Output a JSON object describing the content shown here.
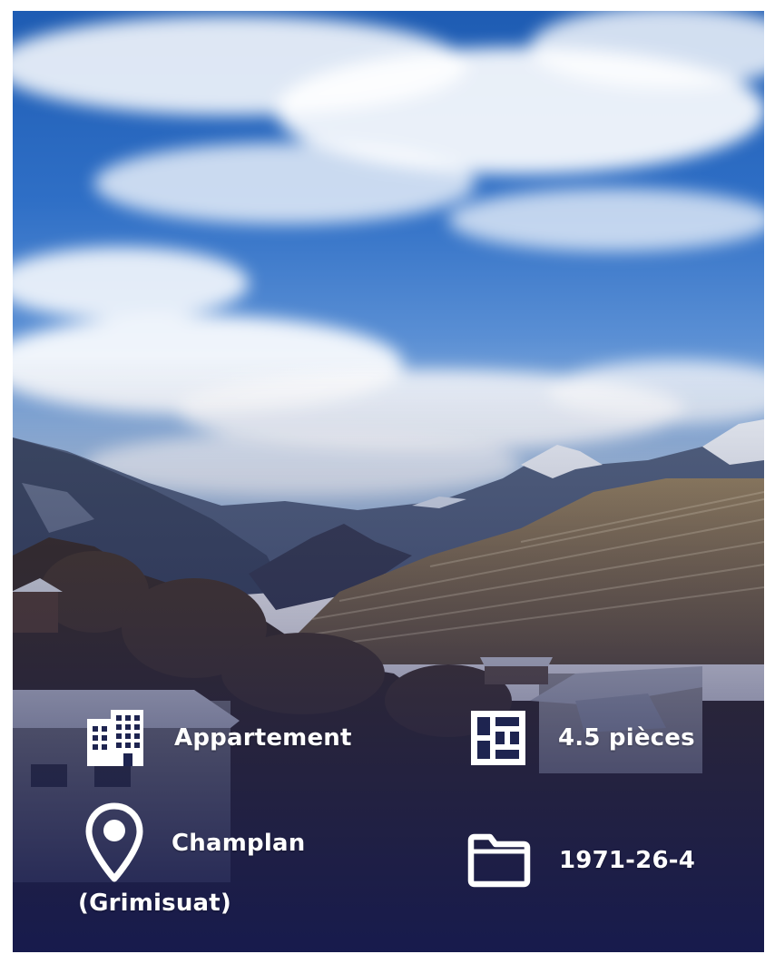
{
  "listing": {
    "property_type": "Appartement",
    "rooms": "4.5 pièces",
    "location_line1": "Champlan",
    "location_line2": "(Grimisuat)",
    "reference": "1971-26-4"
  },
  "icons": {
    "property_type": "building-icon",
    "rooms": "floor-plan-icon",
    "location": "map-pin-icon",
    "reference": "folder-icon"
  },
  "colors": {
    "overlay_bottom": "#161a4e",
    "sky": "#2f6fc6",
    "text": "#ffffff"
  }
}
